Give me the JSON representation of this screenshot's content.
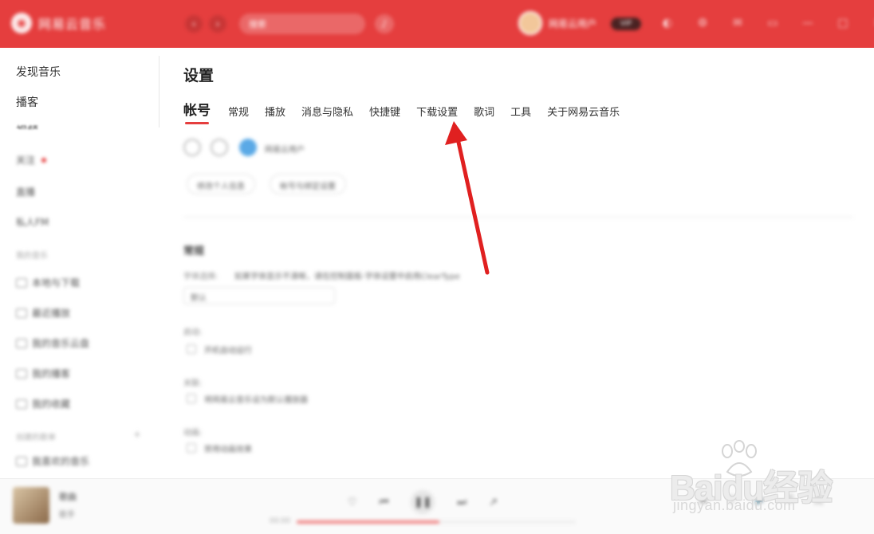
{
  "app": {
    "name": "网易云音乐",
    "accent_color": "#e53e3e"
  },
  "topbar": {
    "search_placeholder": "搜索",
    "username": "网易云用户",
    "vip_label": "VIP"
  },
  "sidebar": {
    "items_clear": [
      {
        "label": "发现音乐"
      },
      {
        "label": "播客"
      },
      {
        "label": "视频"
      }
    ],
    "items_blurred": [
      "关注",
      "直播",
      "私人FM"
    ],
    "section_my": "我的音乐",
    "my_items": [
      "本地与下载",
      "最近播放",
      "我的音乐云盘",
      "我的播客",
      "我的收藏"
    ],
    "section_playlists": "创建的歌单",
    "playlist_items": [
      "我喜欢的音乐"
    ]
  },
  "settings": {
    "title": "设置",
    "tabs": [
      {
        "label": "帐号",
        "active": true
      },
      {
        "label": "常规"
      },
      {
        "label": "播放"
      },
      {
        "label": "消息与隐私"
      },
      {
        "label": "快捷键"
      },
      {
        "label": "下载设置"
      },
      {
        "label": "歌词"
      },
      {
        "label": "工具"
      },
      {
        "label": "关于网易云音乐"
      }
    ]
  },
  "content": {
    "account_name": "网易云用户",
    "btn_edit": "修改个人信息",
    "btn_bind": "帐号与绑定设置",
    "section_general": "常规",
    "font_label": "字体选择:",
    "font_hint": "如果字体显示不清晰，请在控制面板-字体设置中启用ClearType",
    "font_select": "默认",
    "startup_label": "启动:",
    "startup_option": "开机自动运行",
    "associate_label": "关联:",
    "associate_option": "将网易云音乐设为默认播放器",
    "animation_label": "动画:",
    "animation_option": "禁用动画效果"
  },
  "player": {
    "song_name": "歌曲",
    "artist": "歌手",
    "time_current": "00:00",
    "progress_fraction": 0.51
  },
  "watermark": {
    "brand_text": "Baidu经验",
    "url": "jingyan.baidu.com"
  }
}
